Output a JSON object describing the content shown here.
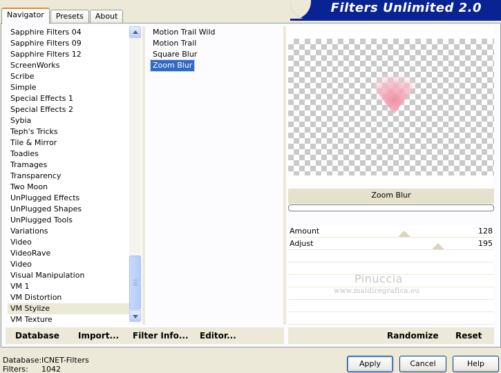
{
  "tabs": [
    "Navigator",
    "Presets",
    "About"
  ],
  "app_title": "Filters Unlimited 2.0",
  "categories": [
    "Sapphire Filters 04",
    "Sapphire Filters 09",
    "Sapphire Filters 12",
    "ScreenWorks",
    "Scribe",
    "Simple",
    "Special Effects 1",
    "Special Effects 2",
    "Sybia",
    "Teph's Tricks",
    "Tile & Mirror",
    "Toadies",
    "Tramages",
    "Transparency",
    "Two Moon",
    "UnPlugged Effects",
    "UnPlugged Shapes",
    "UnPlugged Tools",
    "Variations",
    "Video",
    "VideoRave",
    "Video",
    "Visual Manipulation",
    "VM 1",
    "VM Distortion",
    "VM Stylize",
    "VM Texture"
  ],
  "selected_category": "VM Stylize",
  "filters": [
    "Motion Trail Wild",
    "Motion Trail",
    "Square Blur",
    "Zoom Blur"
  ],
  "selected_filter": "Zoom Blur",
  "filter_name": "Zoom Blur",
  "params": [
    {
      "label": "Amount",
      "value": "128",
      "level": 128
    },
    {
      "label": "Adjust",
      "value": "195",
      "level": 195
    }
  ],
  "watermark": {
    "line1": "Pinuccia",
    "line2": "www.maidiregrafica.eu"
  },
  "toolbar": {
    "database": "Database",
    "import": "Import...",
    "filter_info": "Filter Info...",
    "editor": "Editor...",
    "randomize": "Randomize",
    "reset": "Reset"
  },
  "status": {
    "database_label": "Database:",
    "database_value": "ICNET-Filters",
    "filters_label": "Filters:",
    "filters_value": "1042"
  },
  "buttons": {
    "apply": "Apply",
    "cancel": "Cancel",
    "help": "Help"
  },
  "colors": {
    "banner": "#0A2393",
    "selection": "#316AC5",
    "heart": "#F3A7B5"
  }
}
